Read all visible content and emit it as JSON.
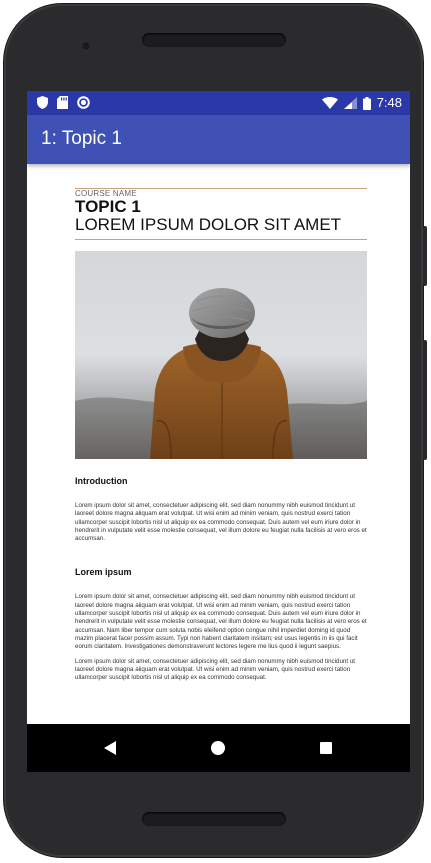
{
  "status_bar": {
    "time": "7:48",
    "icons": [
      "shield-icon",
      "sd-card-icon",
      "record-icon",
      "wifi-icon",
      "signal-icon",
      "battery-icon"
    ]
  },
  "app_bar": {
    "title": "1: Topic 1"
  },
  "document": {
    "course_name": "COURSE NAME",
    "topic": "TOPIC 1",
    "subtitle": "LOREM IPSUM DOLOR SIT AMET",
    "sections": [
      {
        "heading": "Introduction",
        "paragraphs": [
          "Lorem ipsum dolor sit amet, consectetuer adipiscing elit, sed diam nonummy nibh euismod tincidunt ut laoreet dolore magna aliquam erat volutpat. Ut wisi enim ad minim veniam, quis nostrud exerci tation ullamcorper suscipit lobortis nisl ut aliquip ex ea commodo consequat. Duis autem vel eum iriure dolor in hendrerit in vulputate velit esse molestie consequat, vel illum dolore eu feugiat nulla facilisis at vero eros et accumsan."
        ]
      },
      {
        "heading": "Lorem ipsum",
        "paragraphs": [
          "Lorem ipsum dolor sit amet, consectetuer adipiscing elit, sed diam nonummy nibh euismod tincidunt ut laoreet dolore magna aliquam erat volutpat. Ut wisi enim ad minim veniam, quis nostrud exerci tation ullamcorper suscipit lobortis nisl ut aliquip ex ea commodo consequat. Duis autem vel eum iriure dolor in hendrerit in vulputate velit esse molestie consequat, vel illum dolore eu feugiat nulla facilisis at vero eros et accumsan. Nam liber tempor cum soluta nobis eleifend option congue nihil imperdiet doming id quod mazim placerat facer possim assum. Typi non habent claritatem insitam; est usus legentis in iis qui facit eorum claritatem. Investigationes demonstraverunt lectores legere me lius quod ii legunt saepius.",
          "Lorem ipsum dolor sit amet, consectetuer adipiscing elit, sed diam nonummy nibh euismod tincidunt ut laoreet dolore magna aliquam erat volutpat. Ut wisi enim ad minim veniam, quis nostrud exerci tation ullamcorper suscipit lobortis nisl ut aliquip ex ea commodo consequat."
        ]
      }
    ]
  },
  "nav_bar": {
    "icons": [
      "back-icon",
      "home-icon",
      "recents-icon"
    ]
  },
  "colors": {
    "status_bar": "#2a38a8",
    "app_bar": "#3f51b5",
    "accent_rule": "#c9a27a",
    "nav_bar": "#000000"
  }
}
